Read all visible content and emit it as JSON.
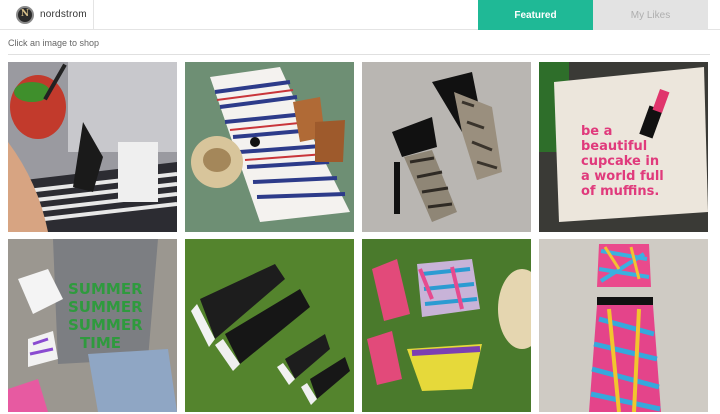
{
  "header": {
    "brand_name": "nordstrom",
    "brand_logo_letter": "N",
    "tabs": [
      {
        "label": "Featured",
        "active": true
      },
      {
        "label": "My Likes",
        "active": false
      }
    ]
  },
  "hint": "Click an image to shop",
  "colors": {
    "accent": "#1fb996",
    "inactive_tab": "#e3e3e3"
  },
  "tiles": [
    {
      "name": "drink-and-striped-outfit-photo"
    },
    {
      "name": "striped-dress-hat-sandals-photo"
    },
    {
      "name": "snakeskin-heels-photo"
    },
    {
      "name": "cupcake-tote-lipstick-photo",
      "print": "be a beautiful cupcake in a world full of muffins."
    },
    {
      "name": "summer-tank-shorts-photo",
      "print": "SUMMER SUMMER SUMMER TIME"
    },
    {
      "name": "black-converse-sneakers-photo"
    },
    {
      "name": "tropical-bikini-sandals-photo"
    },
    {
      "name": "tropical-crop-top-skirt-photo"
    }
  ]
}
